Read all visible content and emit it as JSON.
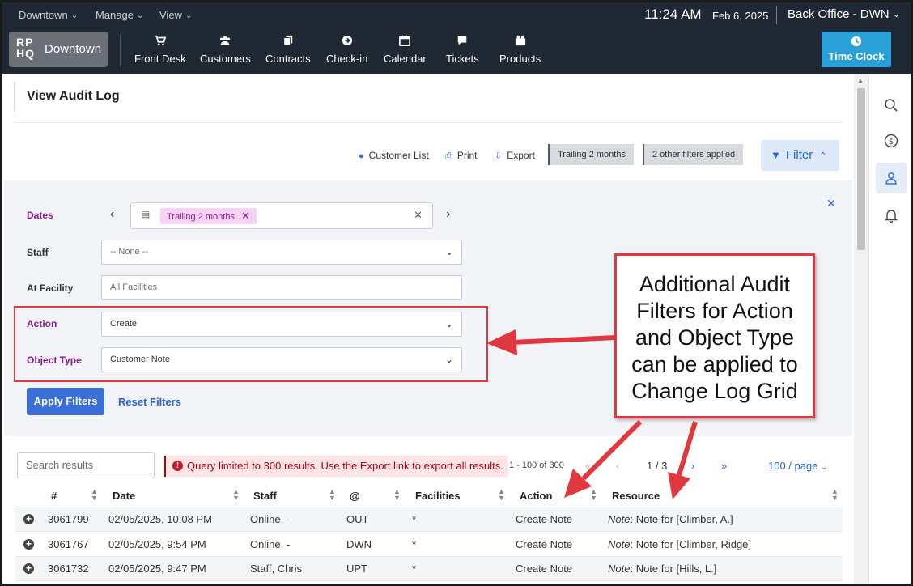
{
  "topbar": {
    "location_menu": "Downtown",
    "manage_menu": "Manage",
    "view_menu": "View",
    "time": "11:24 AM",
    "date": "Feb 6, 2025",
    "office": "Back Office - DWN"
  },
  "brand": {
    "logo_line1": "RP",
    "logo_line2": "HQ",
    "name": "Downtown"
  },
  "nav": {
    "front_desk": "Front Desk",
    "customers": "Customers",
    "contracts": "Contracts",
    "checkin": "Check-in",
    "calendar": "Calendar",
    "tickets": "Tickets",
    "products": "Products",
    "time_clock": "Time Clock"
  },
  "page": {
    "title": "View Audit Log"
  },
  "toolbar": {
    "customer_list": "Customer List",
    "print": "Print",
    "export": "Export",
    "chip1": "Trailing 2 months",
    "chip2": "2 other filters applied",
    "filter": "Filter"
  },
  "filters": {
    "dates_label": "Dates",
    "dates_tag": "Trailing 2 months",
    "staff_label": "Staff",
    "staff_value": "-- None --",
    "facility_label": "At Facility",
    "facility_placeholder": "All Facilities",
    "action_label": "Action",
    "action_value": "Create",
    "object_type_label": "Object Type",
    "object_type_value": "Customer Note",
    "apply": "Apply Filters",
    "reset": "Reset Filters"
  },
  "results": {
    "search_placeholder": "Search results",
    "warning": "Query limited to 300 results. Use the Export link to export all results.",
    "range": "1 - 100 of 300",
    "page": "1 / 3",
    "per_page": "100 / page",
    "columns": [
      "#",
      "Date",
      "Staff",
      "@",
      "Facilities",
      "Action",
      "Resource"
    ],
    "rows": [
      {
        "id": "3061799",
        "date": "02/05/2025, 10:08 PM",
        "staff": "Online, -",
        "at": "OUT",
        "facilities": "*",
        "action": "Create Note",
        "resource_prefix": "Note",
        "resource": ": Note for [Climber, A.]"
      },
      {
        "id": "3061767",
        "date": "02/05/2025, 9:54 PM",
        "staff": "Online, -",
        "at": "DWN",
        "facilities": "*",
        "action": "Create Note",
        "resource_prefix": "Note",
        "resource": ": Note for [Climber, Ridge]"
      },
      {
        "id": "3061732",
        "date": "02/05/2025, 9:47 PM",
        "staff": "Staff, Chris",
        "at": "UPT",
        "facilities": "*",
        "action": "Create Note",
        "resource_prefix": "Note",
        "resource": ": Note for [Hills, L.]"
      }
    ]
  },
  "callout": {
    "text": "Additional Audit Filters for Action and Object Type can be applied to Change Log Grid"
  },
  "colors": {
    "accent": "#3a6fd8",
    "annotation": "#e0383e",
    "purple_label": "#8a1d93"
  }
}
